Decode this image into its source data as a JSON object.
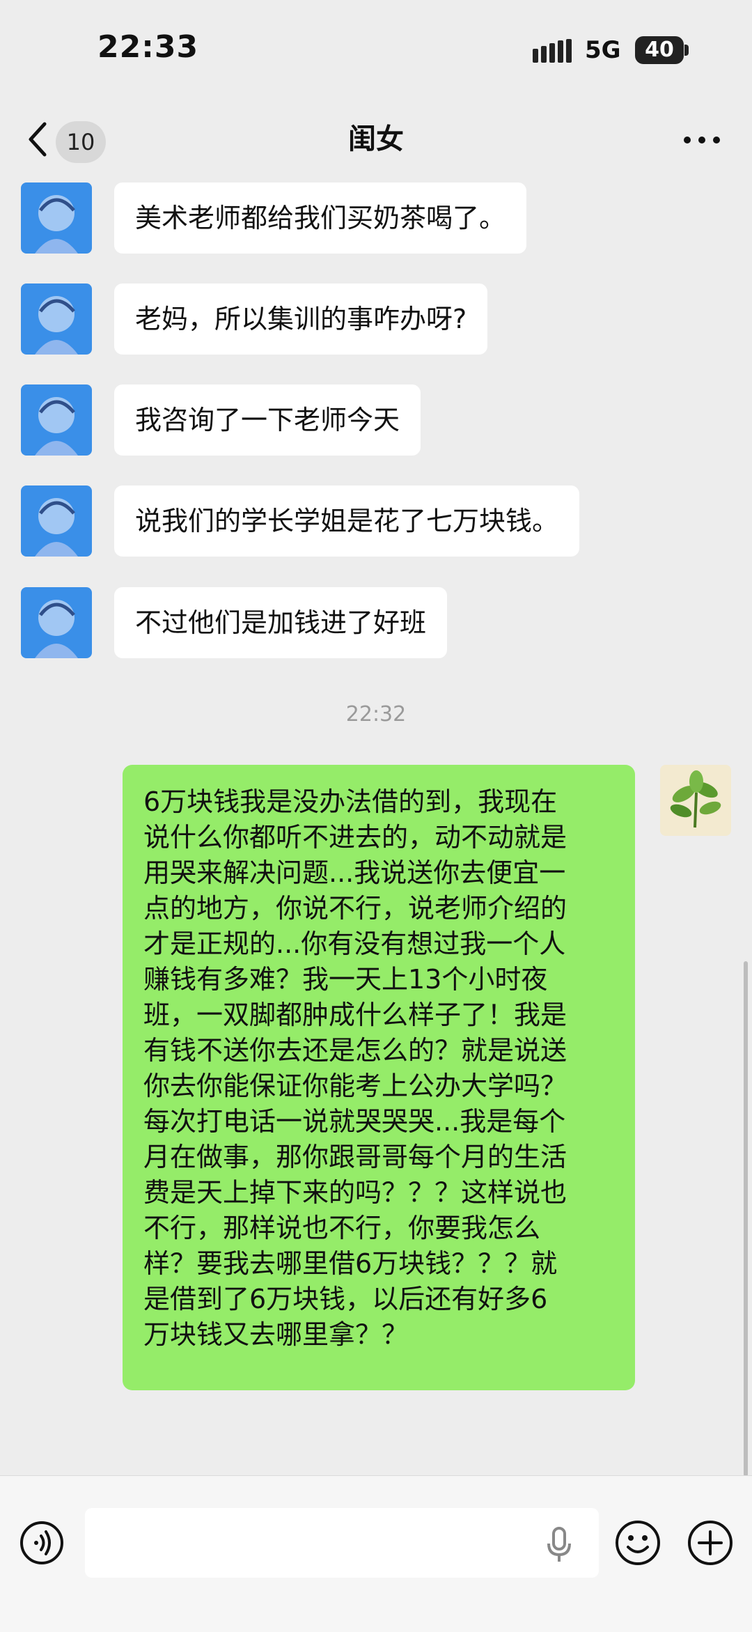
{
  "status_bar": {
    "time": "22:33",
    "network": "5G",
    "battery": "40"
  },
  "header": {
    "back_label": "<",
    "unread_count": "10",
    "title": "闺女"
  },
  "messages_left": [
    {
      "text": "美术老师都给我们买奶茶喝了。"
    },
    {
      "text": "老妈，所以集训的事咋办呀?"
    },
    {
      "text": "我咨询了一下老师今天"
    },
    {
      "text": "说我们的学长学姐是花了七万块钱。"
    },
    {
      "text": "不过他们是加钱进了好班"
    }
  ],
  "timestamp": "22:32",
  "message_right": {
    "lines": [
      "6万块钱我是没办法借的到，我现在",
      "说什么你都听不进去的，动不动就是",
      "用哭来解决问题...我说送你去便宜一",
      "点的地方，你说不行，说老师介绍的",
      "才是正规的...你有没有想过我一个人",
      "赚钱有多难？我一天上13个小时夜",
      "班，一双脚都肿成什么样子了！我是",
      "有钱不送你去还是怎么的？就是说送",
      "你去你能保证你能考上公办大学吗？",
      "每次打电话一说就哭哭哭...我是每个",
      "月在做事，那你跟哥哥每个月的生活",
      "费是天上掉下来的吗？？？这样说也",
      "不行，那样说也不行，你要我怎么",
      "样？要我去哪里借6万块钱？？？就",
      "是借到了6万块钱，以后还有好多6",
      "万块钱又去哪里拿？？"
    ]
  },
  "input_bar": {
    "placeholder": ""
  },
  "colors": {
    "background": "#ededed",
    "bubble_right": "#95ec69",
    "avatar_left": "#3a8fe8"
  },
  "icons": [
    "back-icon",
    "more-icon",
    "voice-icon",
    "mic-icon",
    "emoji-icon",
    "plus-icon"
  ]
}
